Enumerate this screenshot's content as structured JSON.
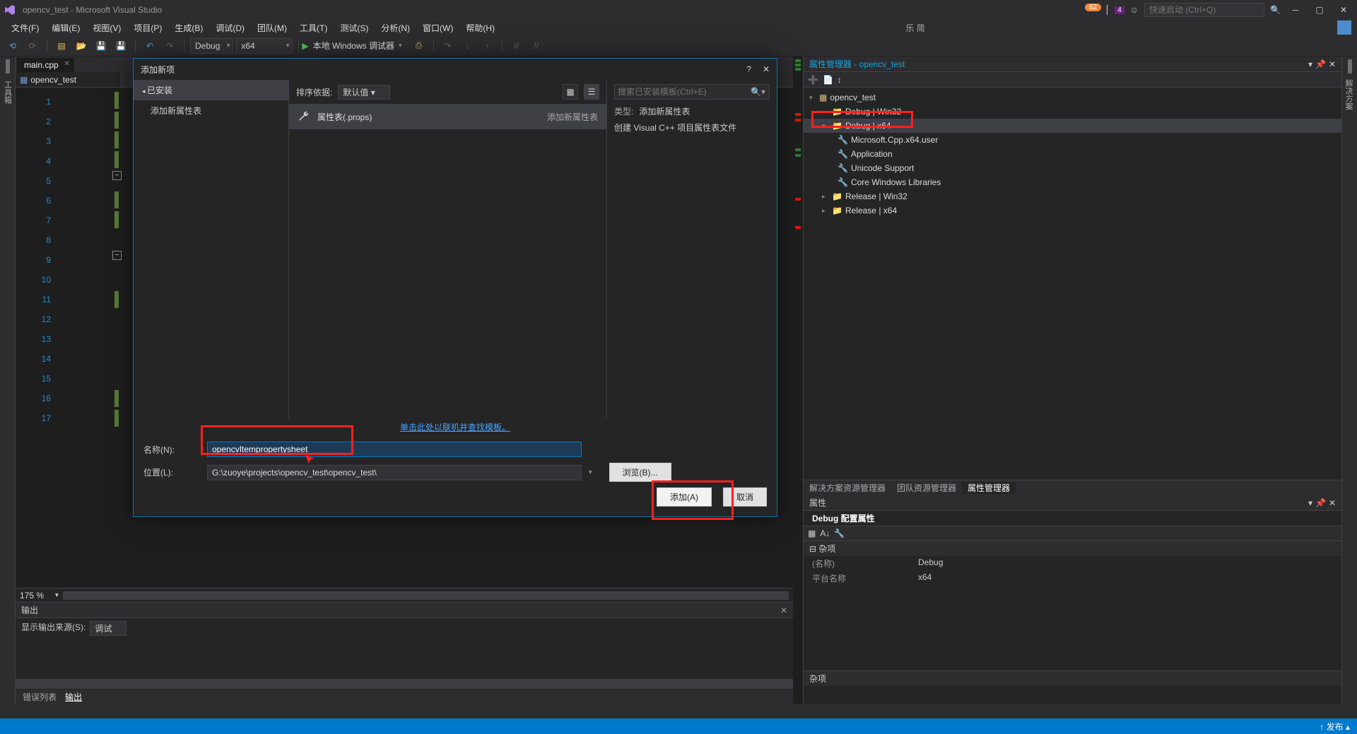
{
  "titlebar": {
    "title": "opencv_test - Microsoft Visual Studio",
    "notif_count": "82",
    "flag_count": "4",
    "quick_launch_placeholder": "快速启动 (Ctrl+Q)"
  },
  "menubar": {
    "items": [
      "文件(F)",
      "编辑(E)",
      "视图(V)",
      "项目(P)",
      "生成(B)",
      "调试(D)",
      "团队(M)",
      "工具(T)",
      "测试(S)",
      "分析(N)",
      "窗口(W)",
      "帮助(H)"
    ],
    "lang": "乐 简"
  },
  "toolbar": {
    "config": "Debug",
    "platform": "x64",
    "debug_btn": "本地 Windows 调试器"
  },
  "editor": {
    "tab": "main.cpp",
    "nav": "opencv_test",
    "lines": [
      "1",
      "2",
      "3",
      "4",
      "5",
      "6",
      "7",
      "8",
      "9",
      "10",
      "11",
      "12",
      "13",
      "14",
      "15",
      "16",
      "17"
    ],
    "zoom": "175 %"
  },
  "output": {
    "title": "输出",
    "source_lbl": "显示输出来源(S):",
    "source_val": "调试"
  },
  "bottom_tabs": {
    "errors": "错误列表",
    "output": "输出"
  },
  "prop_mgr": {
    "title": "属性管理器 - opencv_test",
    "root": "opencv_test",
    "cfgs": [
      "Debug | Win32",
      "Debug | x64",
      "Release | Win32",
      "Release | x64"
    ],
    "debugx64_children": [
      "Microsoft.Cpp.x64.user",
      "Application",
      "Unicode Support",
      "Core Windows Libraries"
    ],
    "tabs": [
      "解决方案资源管理器",
      "团队资源管理器",
      "属性管理器"
    ]
  },
  "props_panel": {
    "title": "属性",
    "obj": "Debug 配置属性",
    "cat": "杂项",
    "rows": [
      {
        "k": "(名称)",
        "v": "Debug"
      },
      {
        "k": "平台名称",
        "v": "x64"
      }
    ],
    "footer": "杂项"
  },
  "dialog": {
    "title": "添加新项",
    "left_installed": "已安装",
    "left_item": "添加新属性表",
    "sort_lbl": "排序依据:",
    "sort_val": "默认值",
    "item_label": "属性表(.props)",
    "item_type": "添加新属性表",
    "search_placeholder": "搜索已安装模板(Ctrl+E)",
    "type_lbl": "类型:",
    "type_val": "添加新属性表",
    "desc": "创建 Visual C++ 项目属性表文件",
    "link": "单击此处以联机并查找模板。",
    "name_lbl": "名称(N):",
    "name_val": "opencvItempropertysheet",
    "loc_lbl": "位置(L):",
    "loc_val": "G:\\zuoye\\projects\\opencv_test\\opencv_test\\",
    "browse": "浏览(B)...",
    "add": "添加(A)",
    "cancel": "取消"
  },
  "statusbar": {
    "publish": "发布"
  },
  "left_vtab": "工具箱",
  "right_vtab": "解决方案"
}
